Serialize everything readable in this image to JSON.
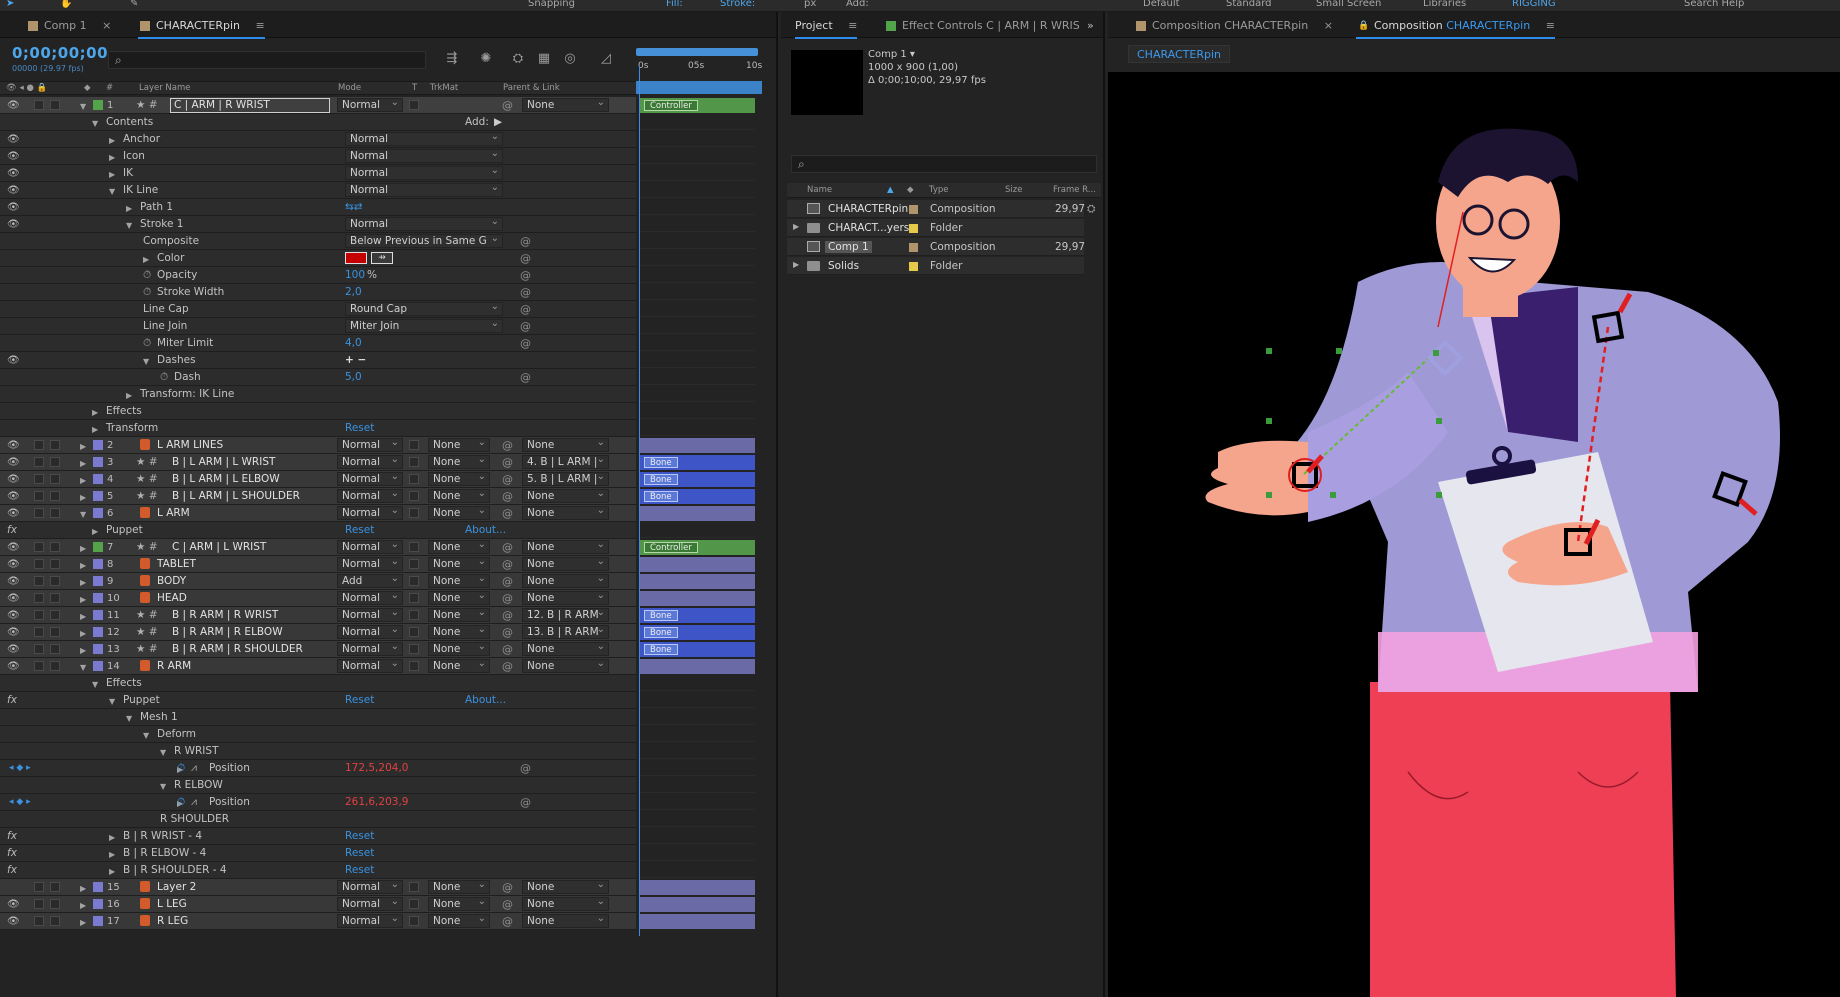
{
  "topbar": {
    "items": [
      "Snapping",
      "Fill:",
      "Stroke:",
      "px",
      "Add:",
      "Default",
      "Standard",
      "Small Screen",
      "Libraries",
      "RIGGING",
      "Search Help"
    ]
  },
  "timeline": {
    "tabs": [
      {
        "label": "Comp 1",
        "color": "#b0946b"
      },
      {
        "label": "CHARACTERpin",
        "color": "#b0946b"
      }
    ],
    "timecode": "0;00;00;00",
    "fps": "00000 (29.97 fps)",
    "search_placeholder": "",
    "columns": {
      "layer_name": "Layer Name",
      "mode": "Mode",
      "t": "T",
      "trkmat": "TrkMat",
      "parent": "Parent & Link",
      "num": "#"
    },
    "ruler": {
      "t0": "0s",
      "t1": "05s",
      "t2": "10s"
    },
    "add_label": "Add:",
    "layers": [
      {
        "num": "1",
        "name": "C | ARM | R WRIST",
        "mode": "Normal",
        "trkmat": "",
        "parent": "None",
        "label": "#52a34a",
        "type": "shape",
        "track": "green",
        "chip": "Controller"
      },
      {
        "num": "2",
        "name": "L ARM LINES",
        "mode": "Normal",
        "trkmat": "None",
        "parent": "None",
        "label": "#7a7ad1",
        "type": "puppet",
        "track": "violet"
      },
      {
        "num": "3",
        "name": "B | L ARM | L WRIST",
        "mode": "Normal",
        "trkmat": "None",
        "parent": "4. B | L ARM |",
        "label": "#7a7ad1",
        "type": "shape",
        "track": "blue",
        "chip": "Bone"
      },
      {
        "num": "4",
        "name": "B | L ARM | L ELBOW",
        "mode": "Normal",
        "trkmat": "None",
        "parent": "5. B | L ARM |",
        "label": "#7a7ad1",
        "type": "shape",
        "track": "blue",
        "chip": "Bone"
      },
      {
        "num": "5",
        "name": "B | L ARM | L SHOULDER",
        "mode": "Normal",
        "trkmat": "None",
        "parent": "None",
        "label": "#7a7ad1",
        "type": "shape",
        "track": "blue",
        "chip": "Bone"
      },
      {
        "num": "6",
        "name": "L ARM",
        "mode": "Normal",
        "trkmat": "None",
        "parent": "None",
        "label": "#7a7ad1",
        "type": "puppet",
        "track": "violet"
      },
      {
        "num": "7",
        "name": "C | ARM | L WRIST",
        "mode": "Normal",
        "trkmat": "None",
        "parent": "None",
        "label": "#52a34a",
        "type": "shape",
        "track": "green",
        "chip": "Controller"
      },
      {
        "num": "8",
        "name": "TABLET",
        "mode": "Normal",
        "trkmat": "None",
        "parent": "None",
        "label": "#7a7ad1",
        "type": "puppet",
        "track": "violet"
      },
      {
        "num": "9",
        "name": "BODY",
        "mode": "Add",
        "trkmat": "None",
        "parent": "None",
        "label": "#7a7ad1",
        "type": "puppet",
        "track": "violet"
      },
      {
        "num": "10",
        "name": "HEAD",
        "mode": "Normal",
        "trkmat": "None",
        "parent": "None",
        "label": "#7a7ad1",
        "type": "puppet",
        "track": "violet"
      },
      {
        "num": "11",
        "name": "B | R ARM | R WRIST",
        "mode": "Normal",
        "trkmat": "None",
        "parent": "12. B | R ARM",
        "label": "#7a7ad1",
        "type": "shape",
        "track": "blue",
        "chip": "Bone"
      },
      {
        "num": "12",
        "name": "B | R ARM | R ELBOW",
        "mode": "Normal",
        "trkmat": "None",
        "parent": "13. B | R ARM",
        "label": "#7a7ad1",
        "type": "shape",
        "track": "blue",
        "chip": "Bone"
      },
      {
        "num": "13",
        "name": "B | R ARM | R SHOULDER",
        "mode": "Normal",
        "trkmat": "None",
        "parent": "None",
        "label": "#7a7ad1",
        "type": "shape",
        "track": "blue",
        "chip": "Bone"
      },
      {
        "num": "14",
        "name": "R ARM",
        "mode": "Normal",
        "trkmat": "None",
        "parent": "None",
        "label": "#7a7ad1",
        "type": "puppet",
        "track": "violet"
      },
      {
        "num": "15",
        "name": "Layer 2",
        "mode": "Normal",
        "trkmat": "None",
        "parent": "None",
        "label": "#7a7ad1",
        "type": "puppet",
        "track": "violet"
      },
      {
        "num": "16",
        "name": "L LEG",
        "mode": "Normal",
        "trkmat": "None",
        "parent": "None",
        "label": "#7a7ad1",
        "type": "puppet",
        "track": "violet"
      },
      {
        "num": "17",
        "name": "R LEG",
        "mode": "Normal",
        "trkmat": "None",
        "parent": "None",
        "label": "#7a7ad1",
        "type": "puppet",
        "track": "violet"
      }
    ],
    "props_layer1": [
      {
        "name": "Contents",
        "indent": 1
      },
      {
        "name": "Anchor",
        "indent": 2,
        "mode": "Normal"
      },
      {
        "name": "Icon",
        "indent": 2,
        "mode": "Normal"
      },
      {
        "name": "IK",
        "indent": 2,
        "mode": "Normal"
      },
      {
        "name": "IK Line",
        "indent": 2,
        "mode": "Normal"
      },
      {
        "name": "Path 1",
        "indent": 3
      },
      {
        "name": "Stroke 1",
        "indent": 3,
        "mode": "Normal"
      },
      {
        "name": "Composite",
        "indent": 4,
        "value": "Below Previous in Same G"
      },
      {
        "name": "Color",
        "indent": 4
      },
      {
        "name": "Opacity",
        "indent": 4,
        "value": "100",
        "unit": "%"
      },
      {
        "name": "Stroke Width",
        "indent": 4,
        "value": "2,0"
      },
      {
        "name": "Line Cap",
        "indent": 4,
        "value": "Round Cap"
      },
      {
        "name": "Line Join",
        "indent": 4,
        "value": "Miter Join"
      },
      {
        "name": "Miter Limit",
        "indent": 4,
        "value": "4,0"
      },
      {
        "name": "Dashes",
        "indent": 4
      },
      {
        "name": "Dash",
        "indent": 5,
        "value": "5,0"
      },
      {
        "name": "Transform: IK Line",
        "indent": 3
      },
      {
        "name": "Effects",
        "indent": 1
      },
      {
        "name": "Transform",
        "indent": 1,
        "value": "Reset"
      }
    ],
    "props_layer6": [
      {
        "name": "Puppet",
        "indent": 1,
        "reset": "Reset",
        "about": "About..."
      }
    ],
    "props_layer14": [
      {
        "name": "Effects",
        "indent": 1
      },
      {
        "name": "Puppet",
        "indent": 2,
        "reset": "Reset",
        "about": "About..."
      },
      {
        "name": "Mesh 1",
        "indent": 3
      },
      {
        "name": "Deform",
        "indent": 4
      },
      {
        "name": "R WRIST",
        "indent": 5
      },
      {
        "name": "Position",
        "indent": 6,
        "value": "172,5,204,0"
      },
      {
        "name": "R ELBOW",
        "indent": 5
      },
      {
        "name": "Position",
        "indent": 6,
        "value": "261,6,203,9"
      },
      {
        "name": "R SHOULDER",
        "indent": 5
      },
      {
        "name": "B | R WRIST - 4",
        "indent": 2,
        "reset": "Reset"
      },
      {
        "name": "B | R ELBOW - 4",
        "indent": 2,
        "reset": "Reset"
      },
      {
        "name": "B | R SHOULDER - 4",
        "indent": 2,
        "reset": "Reset"
      }
    ]
  },
  "project": {
    "tabs": [
      {
        "label": "Project"
      },
      {
        "label": "Effect Controls C | ARM | R WRIS"
      }
    ],
    "comp_name": "Comp 1",
    "comp_info_1": "1000 x 900 (1,00)",
    "comp_info_2": "Δ 0;00;10;00, 29,97 fps",
    "columns": {
      "name": "Name",
      "type": "Type",
      "size": "Size",
      "frame": "Frame R..."
    },
    "items": [
      {
        "name": "CHARACTERpin",
        "type": "Composition",
        "frame": "29,97",
        "color": "#b0946b",
        "kind": "comp"
      },
      {
        "name": "CHARACT...yers",
        "type": "Folder",
        "frame": "",
        "color": "#e6c84a",
        "kind": "folder"
      },
      {
        "name": "Comp 1",
        "type": "Composition",
        "frame": "29,97",
        "color": "#b0946b",
        "kind": "comp",
        "selected": true
      },
      {
        "name": "Solids",
        "type": "Folder",
        "frame": "",
        "color": "#e6c84a",
        "kind": "folder"
      }
    ]
  },
  "composition": {
    "tabs": [
      {
        "label": "Composition CHARACTERpin"
      },
      {
        "label": "Composition",
        "accent": "CHARACTERpin"
      }
    ],
    "breadcrumb": "CHARACTERpin"
  },
  "colors": {
    "accent": "#2d8ceb",
    "timecode": "#4ea6ea",
    "stroke_color": "#c40000"
  }
}
